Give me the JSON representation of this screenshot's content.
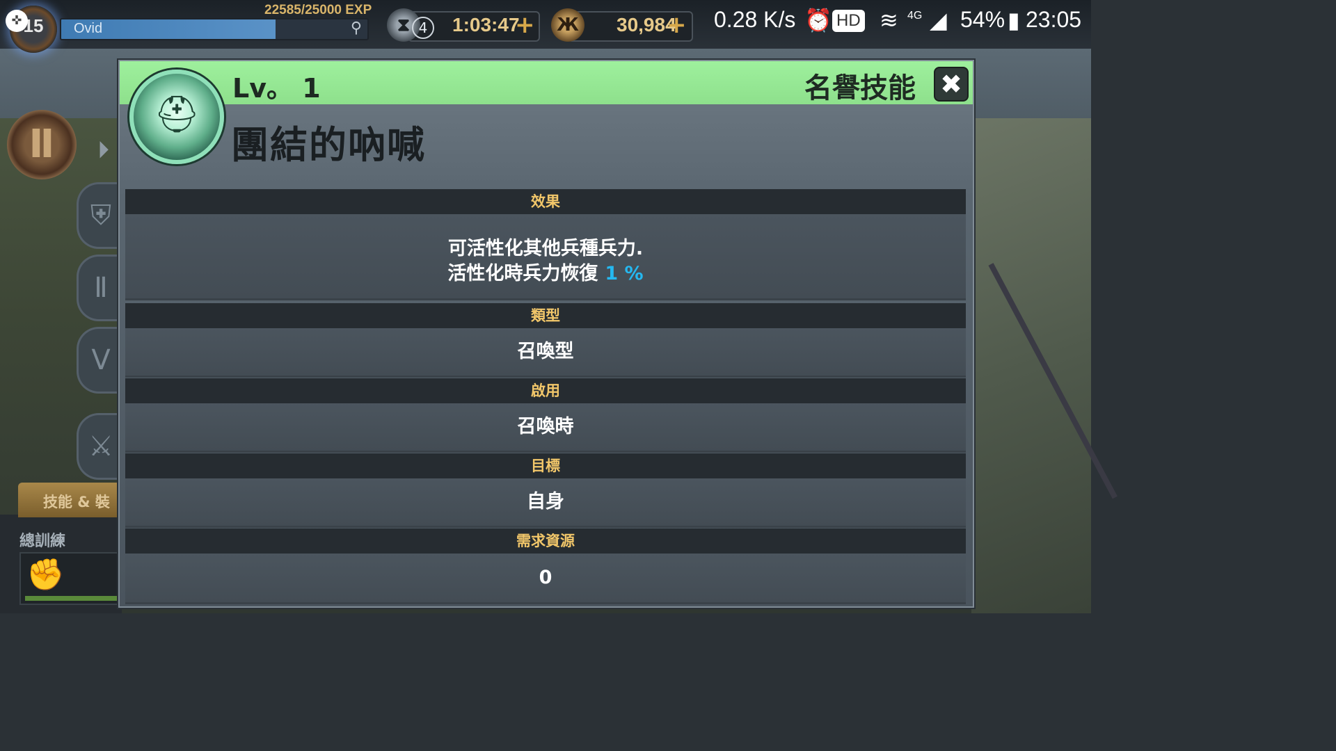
{
  "top_bar": {
    "player_level": "15",
    "player_name": "Ovid",
    "exp_text": "22585/25000 EXP",
    "timer_count": "4",
    "timer_value": "1:03:47",
    "currency_value": "30,984",
    "plus_symbol": "+",
    "currency_icon": "coin-icon"
  },
  "status_bar": {
    "network_speed": "0.28 K/s",
    "hd_label": "HD",
    "network_type": "4G",
    "battery": "54%",
    "time": "23:05"
  },
  "sidebar": {
    "skill_tab_label": "技能 & 裝",
    "training_label": "總訓練"
  },
  "modal": {
    "level_text": "Lv。 1",
    "category": "名譽技能",
    "close_symbol": "✖",
    "skill_name": "團結的吶喊",
    "skill_icon": "spartan-helmet-icon",
    "header_color": "#96ea95",
    "highlight_color": "#25b8f0",
    "sections": [
      {
        "header": "效果",
        "line1": "可活性化其他兵種兵力.",
        "line2": "活性化時兵力恢復",
        "highlight": "1 %"
      },
      {
        "header": "類型",
        "value": "召喚型"
      },
      {
        "header": "啟用",
        "value": "召喚時"
      },
      {
        "header": "目標",
        "value": "自身"
      },
      {
        "header": "需求資源",
        "value": "0"
      }
    ]
  }
}
